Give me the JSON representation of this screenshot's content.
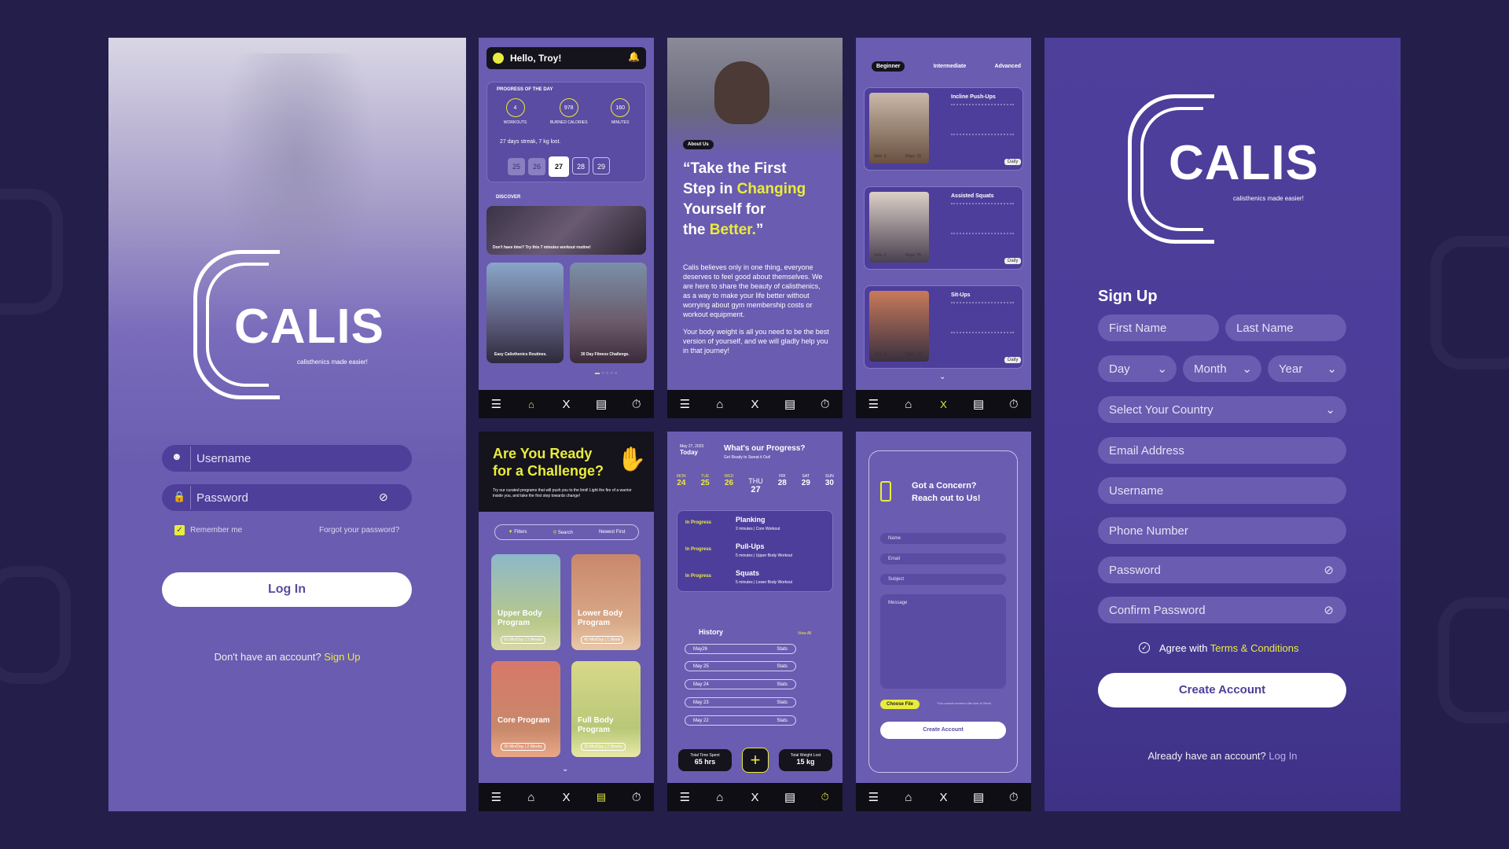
{
  "login": {
    "brand": "CALIS",
    "tagline": "calisthenics made easier!",
    "username_placeholder": "Username",
    "password_placeholder": "Password",
    "remember": "Remember me",
    "forgot": "Forgot your password?",
    "login_btn": "Log In",
    "no_account": "Don't have an account?",
    "signup_link": "Sign Up"
  },
  "dashboard": {
    "greeting": "Hello, Troy!",
    "progress_title": "PROGRESS OF THE DAY",
    "stats": [
      {
        "value": "4",
        "label": "WORKOUTS"
      },
      {
        "value": "978",
        "label": "BURNED CALORIES"
      },
      {
        "value": "160",
        "label": "MINUTES"
      }
    ],
    "streak": "27 days streak, 7 kg lost.",
    "dates": [
      "25",
      "26",
      "27",
      "28",
      "29"
    ],
    "discover": "DISCOVER",
    "discover_caption": "Don't have time? Try this 7 minutes workout routine!",
    "tile1": "Easy Calisthenics Routines.",
    "tile2": "30 Day Fitness Challenge."
  },
  "about": {
    "badge": "About Us",
    "quote_1": "“Take the First",
    "quote_2": "Step in ",
    "quote_2b": "Changing",
    "quote_3": "Yourself for",
    "quote_4": "the ",
    "quote_4b": "Better.",
    "quote_4c": "”",
    "para1": "Calis believes only in one thing, everyone deserves to feel good about themselves. We are here to share the beauty of calisthenics, as a way to make your life better without worrying about gym membership costs or workout equipment.",
    "para2": "Your body weight is all you need to be the best version of yourself, and we will gladly help you in that journey!"
  },
  "exercises": {
    "tabs": [
      "Beginner",
      "Intermediate",
      "Advanced"
    ],
    "items": [
      {
        "name": "Incline Push-Ups",
        "sets": "Sets: 3",
        "reps": "Reps: 15",
        "tag": "Daily"
      },
      {
        "name": "Assisted Squats",
        "sets": "Sets: 2",
        "reps": "Reps: 25",
        "tag": "Daily"
      },
      {
        "name": "Sit-Ups",
        "sets": "Sets: 3",
        "reps": "Reps: 20",
        "tag": "Daily"
      }
    ]
  },
  "challenge": {
    "title_1": "Are You Ready",
    "title_2": "for a Challenge?",
    "sub": "Try our curated programs that will push you to the limit! Light the fire of a warrior inside you, and take the first step towards change!",
    "filters": "Filters",
    "search": "Search",
    "newest": "Newest First",
    "programs": [
      {
        "name": "Upper Body Program",
        "meta": "60 Min/Day | 3 Weeks"
      },
      {
        "name": "Lower Body Program",
        "meta": "45 Min/Day | 1 Week"
      },
      {
        "name": "Core Program",
        "meta": "30 Min/Day | 2 Weeks"
      },
      {
        "name": "Full Body Program",
        "meta": "30 Min/Day | 2 Weeks"
      }
    ]
  },
  "progress": {
    "date": "May 27, 2023",
    "today": "Today",
    "title": "What's our Progress?",
    "sub": "Get Ready to Sweat it Out!",
    "days": [
      {
        "d": "MON",
        "n": "24"
      },
      {
        "d": "TUE",
        "n": "25"
      },
      {
        "d": "WED",
        "n": "26"
      },
      {
        "d": "THU",
        "n": "27"
      },
      {
        "d": "FRI",
        "n": "28"
      },
      {
        "d": "SAT",
        "n": "29"
      },
      {
        "d": "SUN",
        "n": "30"
      }
    ],
    "workouts": [
      {
        "status": "In Progress",
        "name": "Planking",
        "meta": "2 minutes | Core Workout"
      },
      {
        "status": "In Progress",
        "name": "Pull-Ups",
        "meta": "5 minutes | Upper Body Workout"
      },
      {
        "status": "In Progress",
        "name": "Squats",
        "meta": "5 minutes | Lower Body Workout"
      }
    ],
    "history": "History",
    "view_all": "View All",
    "hist": [
      "May26",
      "May 25",
      "May 24",
      "May 23",
      "May 22"
    ],
    "stats_lbl": "Stats",
    "time_lbl": "Total Time Spent",
    "time_val": "65 hrs",
    "weight_lbl": "Total Weight Lost",
    "weight_val": "15 kg"
  },
  "contact": {
    "title_1": "Got a Concern?",
    "title_2": "Reach out to Us!",
    "name": "Name",
    "email": "Email",
    "subject": "Subject",
    "message": "Message",
    "choose": "Choose File",
    "note": "*You cannot exceed a file size of 20mb",
    "btn": "Create Account"
  },
  "signup": {
    "brand": "CALIS",
    "tagline": "calisthenics made easier!",
    "title": "Sign Up",
    "first": "First Name",
    "last": "Last Name",
    "day": "Day",
    "month": "Month",
    "year": "Year",
    "country": "Select Your Country",
    "email": "Email Address",
    "username": "Username",
    "phone": "Phone Number",
    "password": "Password",
    "confirm": "Confirm Password",
    "agree": "Agree with ",
    "terms": "Terms & Conditions",
    "btn": "Create Account",
    "have": "Already have an account?",
    "login": "Log In"
  },
  "nav_labels": {
    "workout": "Workout",
    "programs": "Programs",
    "timer": "Timer"
  },
  "colors": {
    "bg": "#241e4b",
    "panel": "#6a5cb0",
    "accent": "#e9ec3c",
    "dark": "#0f0e14"
  }
}
